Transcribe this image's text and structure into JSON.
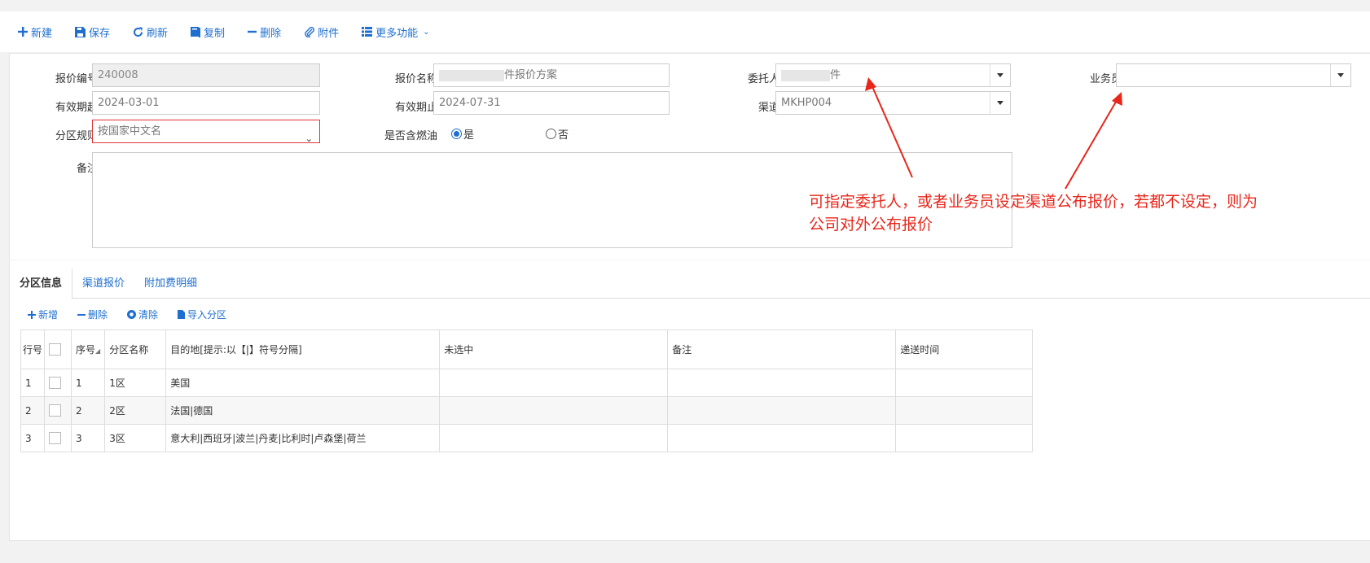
{
  "toolbar": {
    "items": [
      {
        "label": "新建",
        "icon": "plus-icon"
      },
      {
        "label": "保存",
        "icon": "save-icon"
      },
      {
        "label": "刷新",
        "icon": "refresh-icon"
      },
      {
        "label": "复制",
        "icon": "copy-icon"
      },
      {
        "label": "删除",
        "icon": "minus-icon"
      },
      {
        "label": "附件",
        "icon": "paperclip-icon"
      },
      {
        "label": "更多功能",
        "icon": "list-icon"
      }
    ]
  },
  "form": {
    "quote_no": {
      "label": "报价编号",
      "value": "240008"
    },
    "quote_name": {
      "label": "报价名称",
      "value_suffix": "件报价方案"
    },
    "consignor": {
      "label": "委托人",
      "value_suffix": "件"
    },
    "salesman": {
      "label": "业务员",
      "value": ""
    },
    "valid_from": {
      "label": "有效期起",
      "value": "2024-03-01"
    },
    "valid_to": {
      "label": "有效期止",
      "value": "2024-07-31"
    },
    "channel": {
      "label": "渠道",
      "value": "MKHP004"
    },
    "zone_rule": {
      "label": "分区规则",
      "value": "按国家中文名"
    },
    "fuel_included": {
      "label": "是否含燃油",
      "yes": "是",
      "no": "否",
      "selected": "是"
    },
    "remark": {
      "label": "备注",
      "value": ""
    }
  },
  "annotation": {
    "line1": "可指定委托人，或者业务员设定渠道公布报价，若都不设定，则为",
    "line2": "公司对外公布报价",
    "color": "#e8261a"
  },
  "tabs": [
    {
      "label": "分区信息",
      "active": true
    },
    {
      "label": "渠道报价",
      "active": false
    },
    {
      "label": "附加费明细",
      "active": false
    }
  ],
  "sub_toolbar": {
    "add": "新增",
    "delete": "删除",
    "clear": "清除",
    "import": "导入分区"
  },
  "grid": {
    "headers": {
      "row_no": "行号",
      "seq": "序号",
      "zone_name": "分区名称",
      "destination": "目的地[提示:以【|】符号分隔]",
      "unselected": "未选中",
      "remark": "备注",
      "delivery_time": "递送时间"
    },
    "rows": [
      {
        "row_no": "1",
        "seq": "1",
        "zone_name": "1区",
        "destination": "美国",
        "unselected": "",
        "remark": "",
        "delivery_time": ""
      },
      {
        "row_no": "2",
        "seq": "2",
        "zone_name": "2区",
        "destination": "法国|德国",
        "unselected": "",
        "remark": "",
        "delivery_time": ""
      },
      {
        "row_no": "3",
        "seq": "3",
        "zone_name": "3区",
        "destination": "意大利|西班牙|波兰|丹麦|比利时|卢森堡|荷兰",
        "unselected": "",
        "remark": "",
        "delivery_time": ""
      }
    ]
  },
  "colors": {
    "accent": "#1e6fd0",
    "required_border": "#e03333"
  }
}
